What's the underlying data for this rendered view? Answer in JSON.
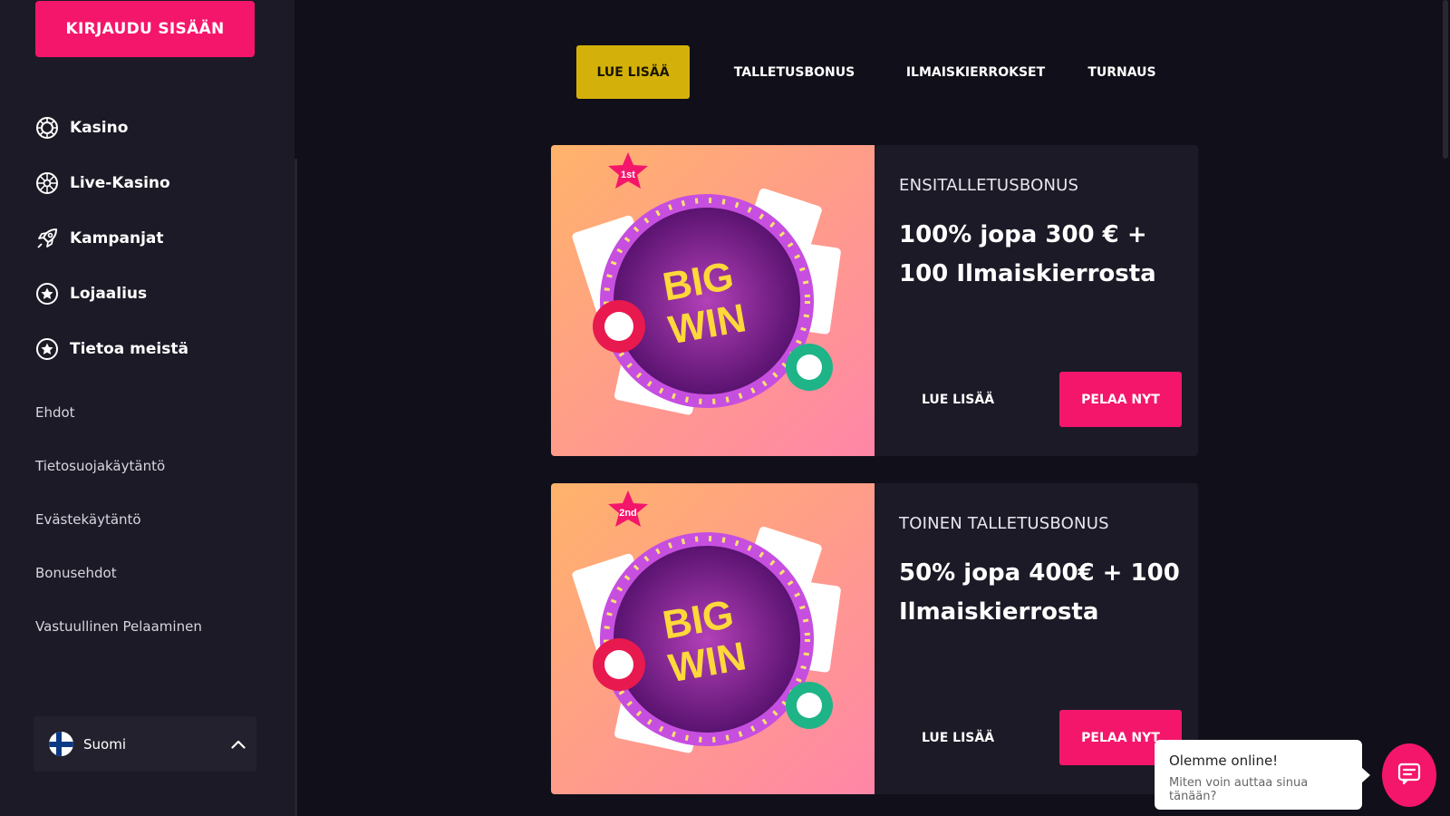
{
  "sidebar": {
    "login_label": "KIRJAUDU SISÄÄN",
    "nav": [
      {
        "label": "Kasino",
        "icon": "casino-chip-icon"
      },
      {
        "label": "Live-Kasino",
        "icon": "roulette-icon"
      },
      {
        "label": "Kampanjat",
        "icon": "rocket-icon"
      },
      {
        "label": "Lojaalius",
        "icon": "star-circle-icon"
      },
      {
        "label": "Tietoa meistä",
        "icon": "star-circle-icon"
      }
    ],
    "links": [
      "Ehdot",
      "Tietosuojakäytäntö",
      "Evästekäytäntö",
      "Bonusehdot",
      "Vastuullinen Pelaaminen"
    ],
    "language": "Suomi"
  },
  "tabs": [
    "LUE LISÄÄ",
    "TALLETUSBONUS",
    "ILMAISKIERROKSET",
    "TURNAUS"
  ],
  "cards": [
    {
      "badge": "1st",
      "image_text": [
        "BIG",
        "WIN"
      ],
      "subtitle": "ENSITALLETUSBONUS",
      "title": "100% jopa 300 € + 100 Ilmaiskierrosta",
      "more_label": "LUE LISÄÄ",
      "play_label": "PELAA NYT"
    },
    {
      "badge": "2nd",
      "image_text": [
        "BIG",
        "WIN"
      ],
      "subtitle": "TOINEN TALLETUSBONUS",
      "title": "50% jopa 400€ + 100 Ilmaiskierrosta",
      "more_label": "LUE LISÄÄ",
      "play_label": "PELAA NYT"
    }
  ],
  "chat": {
    "title": "Olemme online!",
    "text": "Miten voin auttaa sinua tänään?"
  },
  "colors": {
    "accent_pink": "#f4166b",
    "accent_gold": "#d4b10a",
    "background": "#110f19",
    "sidebar": "#1c1a26"
  }
}
